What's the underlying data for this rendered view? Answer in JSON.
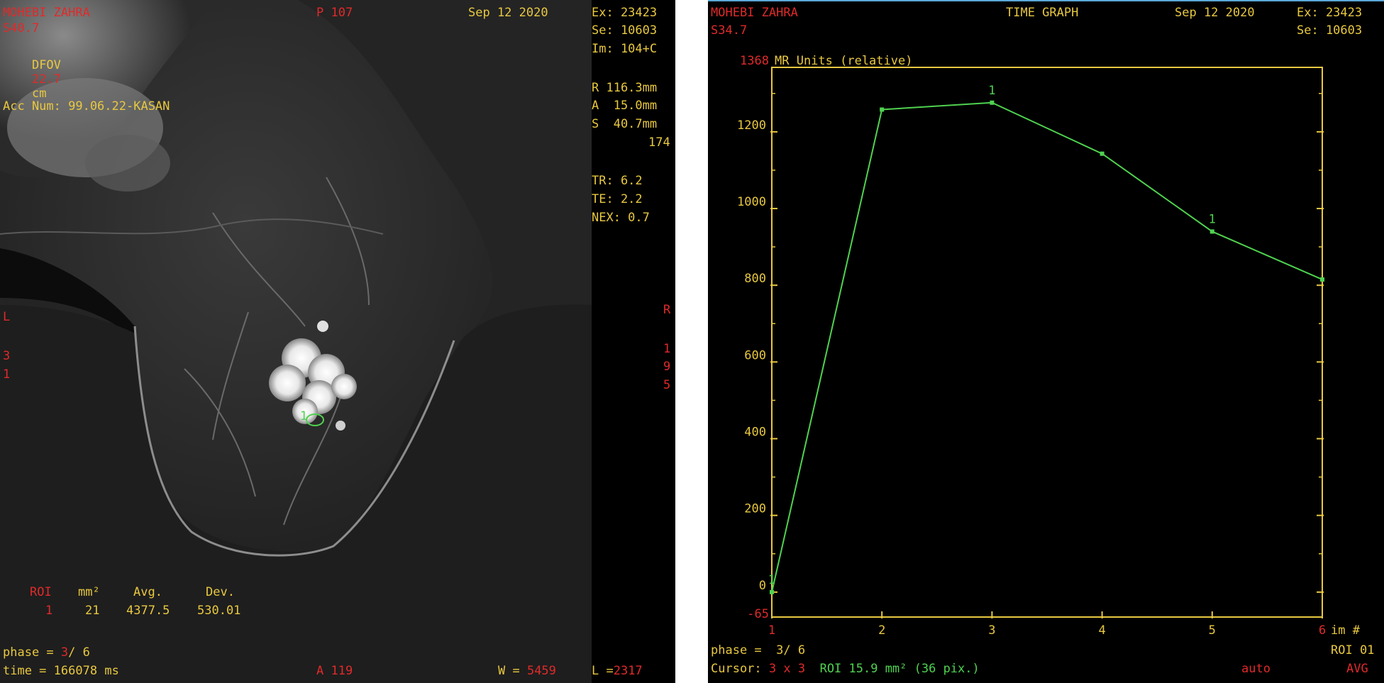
{
  "left": {
    "patient_name": "MOHEBI ZAHRA",
    "slice_pos": "S40.7",
    "dfov_label": "DFOV",
    "dfov_value": "22.7",
    "dfov_unit": "cm",
    "acc_num": "Acc Num: 99.06.22-KASAN",
    "top_center": "P 107",
    "date": "Sep 12 2020",
    "exam": "Ex: 23423",
    "series": "Se: 10603",
    "image": "Im: 104+C",
    "r_pos": "R 116.3mm",
    "a_pos": "A  15.0mm",
    "s_pos": "S  40.7mm",
    "num_174": "174",
    "tr": "TR: 6.2",
    "te": "TE: 2.2",
    "nex": "NEX: 0.7",
    "left_marker": "L",
    "left_nums": [
      "3",
      "1"
    ],
    "right_marker": "R",
    "right_nums": [
      "1",
      "9",
      "5"
    ],
    "roi_marker": "1",
    "roi_table": {
      "headers": [
        "ROI",
        "mm²",
        "Avg.",
        "Dev."
      ],
      "row": [
        "1",
        "21",
        "4377.5",
        "530.01"
      ]
    },
    "phase_label": "phase = ",
    "phase_current": "3",
    "phase_total": "/ 6",
    "time_label": "time = ",
    "time_value": "166078",
    "time_unit": "ms",
    "bottom_a": "A 119",
    "w_label": "W = ",
    "w_value": "5459",
    "l_label": "L =",
    "l_value": "2317"
  },
  "right": {
    "patient_name": "MOHEBI ZAHRA",
    "slice_pos": "S34.7",
    "title": "TIME GRAPH",
    "date": "Sep 12 2020",
    "exam": "Ex: 23423",
    "series": "Se: 10603",
    "phase_label": "phase =  3/ 6",
    "cursor_label": "Cursor:",
    "cursor_value": "3 x 3",
    "roi_info": "ROI 15.9 mm² (36 pix.)",
    "auto": "auto",
    "roi_id": "ROI 01",
    "avg": "AVG"
  },
  "chart_data": {
    "type": "line",
    "ylabel": "MR Units (relative)",
    "ymax_label": "1368",
    "ymin_label": "-65",
    "xlabel": "im #",
    "ylim": [
      -65,
      1368
    ],
    "xlim": [
      1,
      6
    ],
    "x_ticks": [
      "1",
      "2",
      "3",
      "4",
      "5",
      "6"
    ],
    "y_ticks": [
      "0",
      "200",
      "400",
      "600",
      "800",
      "1000",
      "1200"
    ],
    "series": [
      {
        "x": [
          1,
          2,
          3,
          4,
          5,
          6
        ],
        "values": [
          0,
          1258,
          1276,
          1143,
          940,
          815
        ]
      }
    ],
    "point_markers": [
      {
        "x": 1,
        "label": "1"
      },
      {
        "x": 3,
        "label": "1"
      },
      {
        "x": 5,
        "label": "1"
      }
    ],
    "colors": {
      "line": "#4fd24f",
      "axis": "#e8c840",
      "min_label": "#e02a2a"
    }
  }
}
